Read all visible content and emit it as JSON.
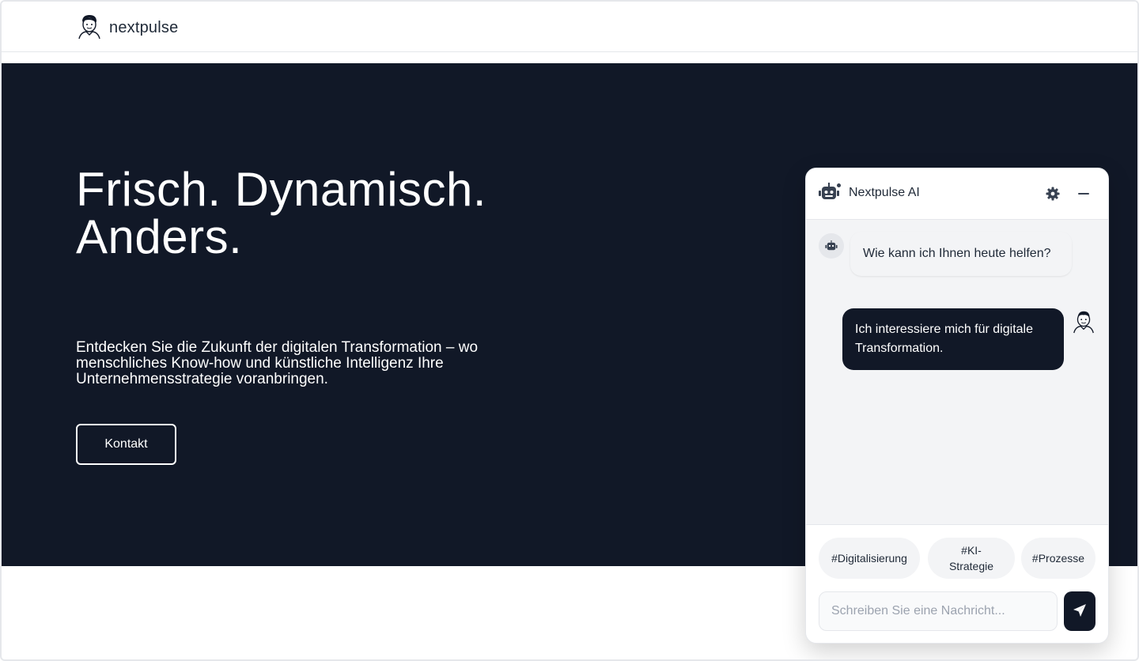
{
  "header": {
    "brand_name": "nextpulse",
    "logo_icon": "person-sketch-avatar"
  },
  "hero": {
    "title_line1": "Frisch. Dynamisch.",
    "title_line2": "Anders.",
    "subtitle": "Entdecken Sie die Zukunft der digitalen Transformation – wo menschliches Know-how und künstliche Intelligenz Ihre Unternehmensstrategie voranbringen.",
    "cta_label": "Kontakt",
    "background_color": "#111827"
  },
  "chat": {
    "title": "Nextpulse AI",
    "header_icons": [
      "robot-icon",
      "gear-icon",
      "minimize-icon"
    ],
    "messages": [
      {
        "from": "bot",
        "text": "Wie kann ich Ihnen heute helfen?"
      },
      {
        "from": "user",
        "text": "Ich interessiere mich für digitale Transformation."
      }
    ],
    "tags": [
      "#Digitalisierung",
      "#KI-Strategie",
      "#Prozesse"
    ],
    "input_placeholder": "Schreiben Sie eine Nachricht...",
    "send_icon": "paper-plane-icon",
    "accent_color": "#111827"
  }
}
